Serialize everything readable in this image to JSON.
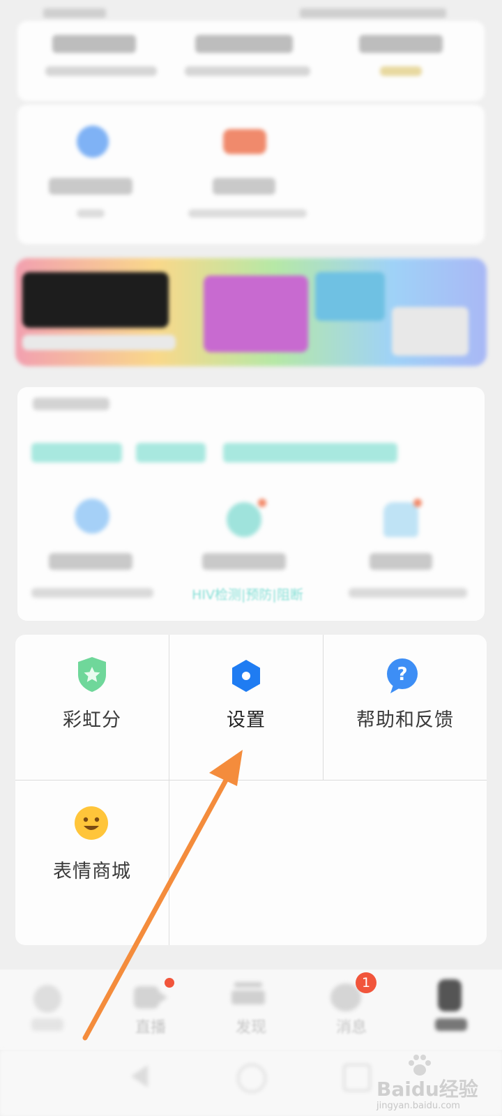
{
  "grid": {
    "items": [
      {
        "label": "彩虹分",
        "icon": "shield-star-icon"
      },
      {
        "label": "设置",
        "icon": "settings-hexagon-icon"
      },
      {
        "label": "帮助和反馈",
        "icon": "help-bubble-icon"
      },
      {
        "label": "表情商城",
        "icon": "smiley-icon"
      }
    ]
  },
  "services": {
    "subtitle": "HIV检测|预防|阻断"
  },
  "bottom_nav": {
    "items": [
      {
        "label": "直播",
        "badge": ""
      },
      {
        "label": "发现",
        "badge": ""
      },
      {
        "label": "消息",
        "badge": "1"
      }
    ]
  },
  "watermark": {
    "brand": "Baidu经验",
    "url": "jingyan.baidu.com"
  },
  "colors": {
    "accent_blue": "#1f7cf2",
    "green": "#5fd48e",
    "yellow": "#ffc53a",
    "arrow_orange": "#f48c3c",
    "badge_red": "#f1553b"
  }
}
